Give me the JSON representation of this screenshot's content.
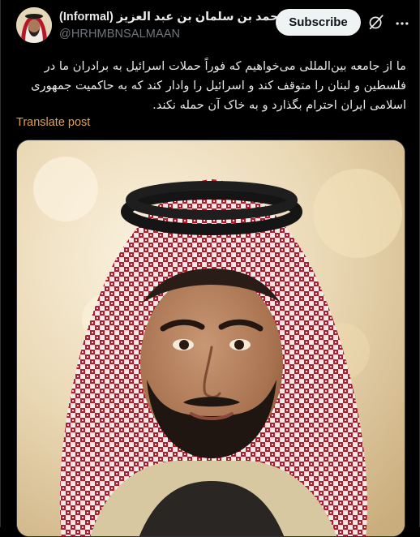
{
  "header": {
    "display_name": "محمد بن سلمان بن عبد العزيز (Informal)",
    "handle": "@HRHMBNSALMAAN",
    "subscribe_label": "Subscribe",
    "verified_color": "#1d9bf0"
  },
  "post": {
    "text": "ما از جامعه بین‌المللی می‌خواهیم که فوراً حملات اسرائیل به برادران ما در فلسطین و لبنان را متوقف کند و اسرائیل را وادار کند که به حاکمیت جمهوری اسلامی ایران احترام بگذارد و به خاک آن حمله نکند.",
    "translate_label": "Translate post",
    "translate_color": "#e0a24a"
  },
  "icons": {
    "verified": "verified-badge-icon",
    "grok": "grok-icon",
    "more": "more-icon"
  },
  "colors": {
    "background": "#000000",
    "text": "#e7e9ea",
    "secondary": "#71767b",
    "subscribe_bg": "#eff3f4",
    "accent": "#1d9bf0"
  }
}
